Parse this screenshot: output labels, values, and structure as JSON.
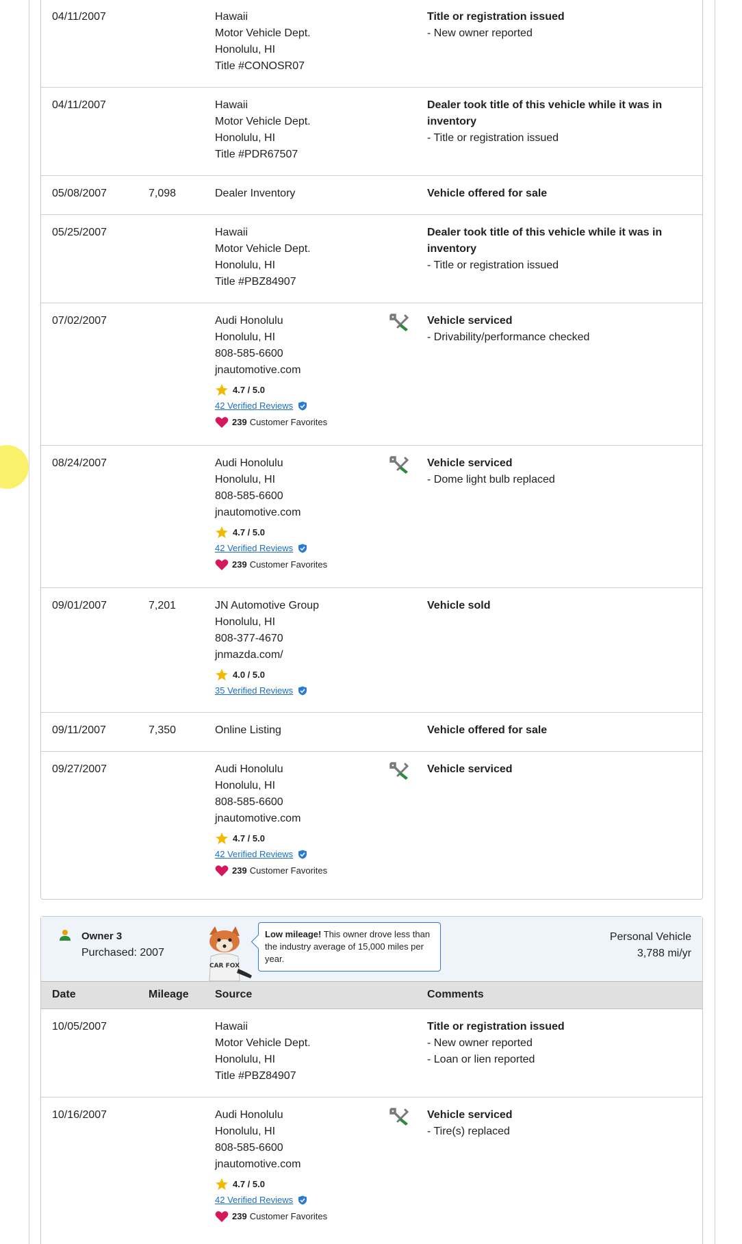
{
  "owner2_records": [
    {
      "date": "04/11/2007",
      "mileage": "",
      "source": [
        "Hawaii",
        "Motor Vehicle Dept.",
        "Honolulu, HI",
        "Title #CONOSR07"
      ],
      "service_icon": false,
      "comment_title": "Title or registration issued",
      "comment_items": [
        "New owner reported"
      ]
    },
    {
      "date": "04/11/2007",
      "mileage": "",
      "source": [
        "Hawaii",
        "Motor Vehicle Dept.",
        "Honolulu, HI",
        "Title #PDR67507"
      ],
      "service_icon": false,
      "comment_title": "Dealer took title of this vehicle while it was in inventory",
      "comment_items": [
        "Title or registration issued"
      ]
    },
    {
      "date": "05/08/2007",
      "mileage": "7,098",
      "source": [
        "Dealer Inventory"
      ],
      "service_icon": false,
      "comment_title": "Vehicle offered for sale",
      "comment_items": []
    },
    {
      "date": "05/25/2007",
      "mileage": "",
      "source": [
        "Hawaii",
        "Motor Vehicle Dept.",
        "Honolulu, HI",
        "Title #PBZ84907"
      ],
      "service_icon": false,
      "comment_title": "Dealer took title of this vehicle while it was in inventory",
      "comment_items": [
        "Title or registration issued"
      ]
    },
    {
      "date": "07/02/2007",
      "mileage": "",
      "source": [
        "Audi Honolulu",
        "Honolulu, HI",
        "808-585-6600",
        "jnautomotive.com"
      ],
      "rating": "4.7 / 5.0",
      "reviews": "42 Verified Reviews",
      "favorites_count": "239",
      "favorites_label": "Customer Favorites",
      "service_icon": true,
      "comment_title": "Vehicle serviced",
      "comment_items": [
        "Drivability/performance checked"
      ]
    },
    {
      "date": "08/24/2007",
      "mileage": "",
      "source": [
        "Audi Honolulu",
        "Honolulu, HI",
        "808-585-6600",
        "jnautomotive.com"
      ],
      "rating": "4.7 / 5.0",
      "reviews": "42 Verified Reviews",
      "favorites_count": "239",
      "favorites_label": "Customer Favorites",
      "service_icon": true,
      "comment_title": "Vehicle serviced",
      "comment_items": [
        "Dome light bulb replaced"
      ]
    },
    {
      "date": "09/01/2007",
      "mileage": "7,201",
      "source": [
        "JN Automotive Group",
        "Honolulu, HI",
        "808-377-4670",
        "jnmazda.com/"
      ],
      "rating": "4.0 / 5.0",
      "reviews": "35 Verified Reviews",
      "service_icon": false,
      "comment_title": "Vehicle sold",
      "comment_items": []
    },
    {
      "date": "09/11/2007",
      "mileage": "7,350",
      "source": [
        "Online Listing"
      ],
      "service_icon": false,
      "comment_title": "Vehicle offered for sale",
      "comment_items": []
    },
    {
      "date": "09/27/2007",
      "mileage": "",
      "source": [
        "Audi Honolulu",
        "Honolulu, HI",
        "808-585-6600",
        "jnautomotive.com"
      ],
      "rating": "4.7 / 5.0",
      "reviews": "42 Verified Reviews",
      "favorites_count": "239",
      "favorites_label": "Customer Favorites",
      "service_icon": true,
      "comment_title": "Vehicle serviced",
      "comment_items": []
    }
  ],
  "owner3": {
    "name": "Owner 3",
    "purchased": "Purchased: 2007",
    "bubble_bold": "Low mileage!",
    "bubble_text": " This owner drove less than the industry average of 15,000 miles per year.",
    "type": "Personal Vehicle",
    "usage": "3,788 mi/yr",
    "fox_shirt_text": "CAR FOX"
  },
  "table_headers": {
    "date": "Date",
    "mileage": "Mileage",
    "source": "Source",
    "comments": "Comments"
  },
  "owner3_records": [
    {
      "date": "10/05/2007",
      "mileage": "",
      "source": [
        "Hawaii",
        "Motor Vehicle Dept.",
        "Honolulu, HI",
        "Title #PBZ84907"
      ],
      "service_icon": false,
      "comment_title": "Title or registration issued",
      "comment_items": [
        "New owner reported",
        "Loan or lien reported"
      ]
    },
    {
      "date": "10/16/2007",
      "mileage": "",
      "source": [
        "Audi Honolulu",
        "Honolulu, HI",
        "808-585-6600",
        "jnautomotive.com"
      ],
      "rating": "4.7 / 5.0",
      "reviews": "42 Verified Reviews",
      "favorites_count": "239",
      "favorites_label": "Customer Favorites",
      "service_icon": true,
      "comment_title": "Vehicle serviced",
      "comment_items": [
        "Tire(s) replaced"
      ]
    }
  ],
  "colors": {
    "link": "#1b6fc7",
    "star": "#f5b800",
    "heart": "#d6175b",
    "verified": "#2a7bd1",
    "owner_icon": "#e5a100",
    "owner_bar_bg": "#eef4fa",
    "wrench": "#7a7a7a",
    "screwdriver": "#2e8b3a"
  },
  "icons": {
    "service": "service-wrench-screwdriver-icon",
    "star": "star-icon",
    "verified": "verified-shield-icon",
    "heart": "heart-icon",
    "owner": "owner-person-icon"
  }
}
